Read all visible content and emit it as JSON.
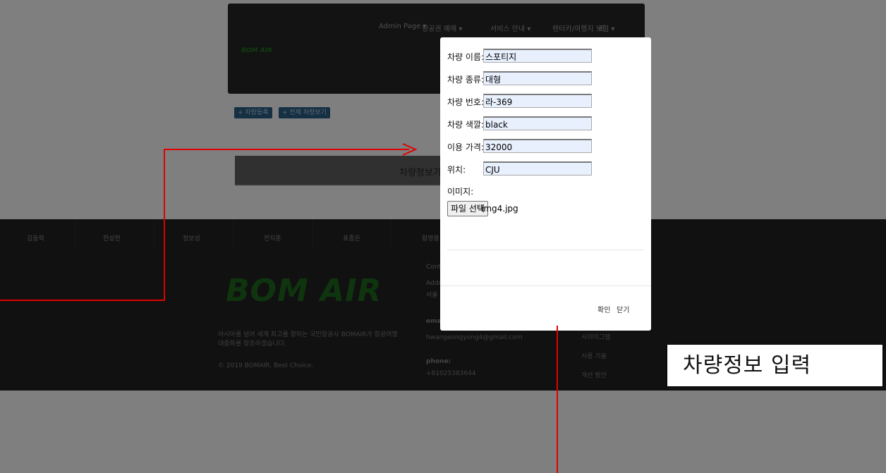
{
  "header": {
    "nav_items": [
      "Admin Page ▾",
      "항공권 예매 ▾",
      "서비스 안내 ▾",
      "렌터카/여행지 보험 ▾",
      "로"
    ],
    "logo": "BOM AIR"
  },
  "toolbar": {
    "register_label": "+ 차량등록",
    "view_all_label": "+ 전체 차량보기"
  },
  "main": {
    "info_text": "차량정보가"
  },
  "footer": {
    "names": [
      "김동혁",
      "한상현",
      "정보성",
      "전지훈",
      "표종은",
      "황영용"
    ],
    "logo": "BOM AIR",
    "description": "아시아를 넘어 세계 최고를 향하는 국민항공사 BOMAIR가 항공여행 대중화를 창조하겠습니다.",
    "copyright": "© 2019 BOMAIR. Best Choice.",
    "contact_label": "Conta",
    "address_label": "Addr",
    "address_value": "서울",
    "email_label": "email",
    "email": "hwangeongyong4@gmail.com",
    "phone_label": "phone:",
    "phone": "+81025383644",
    "links": [
      "시이어그램",
      "사용 기술",
      "개선 방안"
    ]
  },
  "modal": {
    "fields": [
      {
        "label": "차량 이름:",
        "value": "스포티지"
      },
      {
        "label": "차량 종류:",
        "value": "대형"
      },
      {
        "label": "차량 번호:",
        "value": "라-369"
      },
      {
        "label": "차량 색깔:",
        "value": "black"
      },
      {
        "label": "이용 가격:",
        "value": "32000"
      },
      {
        "label": "위치:",
        "value": "CJU"
      }
    ],
    "image_label": "이미지:",
    "file_button": "파일 선택",
    "file_name": "img4.jpg",
    "confirm_label": "확인",
    "close_label": "닫기"
  },
  "annotation": {
    "callout": "차량정보 입력",
    "color": "#e00000"
  }
}
